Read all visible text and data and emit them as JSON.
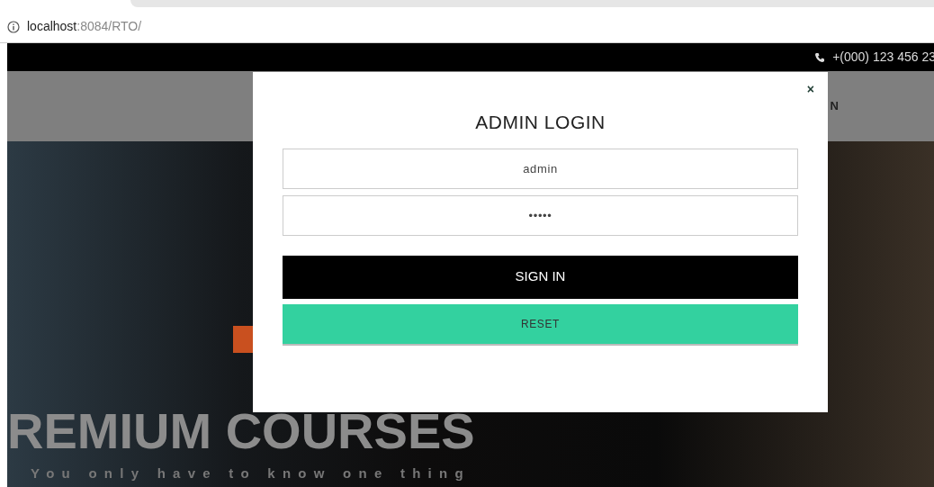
{
  "address_bar": {
    "host": "localhost",
    "path": ":8084/RTO/"
  },
  "top_bar": {
    "phone": "+(000) 123 456 23"
  },
  "nav": {
    "item_partial": "N"
  },
  "hero": {
    "heading": "REMIUM COURSES",
    "subtitle": "You only have to know one thing"
  },
  "modal": {
    "close": "×",
    "title": "ADMIN LOGIN",
    "username": "admin",
    "password": "•••••",
    "buttons": [
      {
        "kind": "primary",
        "label": "SIGN IN"
      },
      {
        "kind": "secondary",
        "label": "RESET"
      }
    ]
  }
}
